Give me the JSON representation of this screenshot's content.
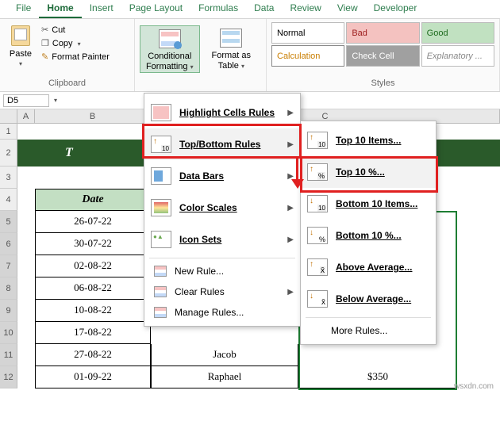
{
  "tabs": [
    "File",
    "Home",
    "Insert",
    "Page Layout",
    "Formulas",
    "Data",
    "Review",
    "View",
    "Developer"
  ],
  "active_tab": "Home",
  "clipboard": {
    "paste": "Paste",
    "cut": "Cut",
    "copy": "Copy",
    "format_painter": "Format Painter",
    "group_label": "Clipboard"
  },
  "cf": {
    "conditional": "Conditional Formatting",
    "format_as_table": "Format as Table"
  },
  "styles": {
    "normal": "Normal",
    "bad": "Bad",
    "good": "Good",
    "calculation": "Calculation",
    "check_cell": "Check Cell",
    "explanatory": "Explanatory ...",
    "group_label": "Styles"
  },
  "namebox": "D5",
  "col_headers": [
    "A",
    "B",
    "C"
  ],
  "row_headers": [
    "1",
    "2",
    "3",
    "4",
    "5",
    "6",
    "7",
    "8",
    "9",
    "10",
    "11",
    "12"
  ],
  "table": {
    "title_visible": "T",
    "headers": {
      "date": "Date",
      "col_c_hidden": "",
      "col_d_hidden": ""
    },
    "rows": [
      {
        "date": "26-07-22",
        "c": "",
        "d": ""
      },
      {
        "date": "30-07-22",
        "c": "",
        "d": ""
      },
      {
        "date": "02-08-22",
        "c": "",
        "d": ""
      },
      {
        "date": "06-08-22",
        "c": "",
        "d": ""
      },
      {
        "date": "10-08-22",
        "c": "",
        "d": ""
      },
      {
        "date": "17-08-22",
        "c": "",
        "d": ""
      },
      {
        "date": "27-08-22",
        "c": "Jacob",
        "d": ""
      },
      {
        "date": "01-09-22",
        "c": "Raphael",
        "d": "$350"
      }
    ]
  },
  "menu1": {
    "highlight": "Highlight Cells Rules",
    "topbottom": "Top/Bottom Rules",
    "databars": "Data Bars",
    "colorscales": "Color Scales",
    "iconsets": "Icon Sets",
    "newrule": "New Rule...",
    "clear": "Clear Rules",
    "manage": "Manage Rules..."
  },
  "menu2": {
    "top10items": "Top 10 Items...",
    "top10pct": "Top 10 %...",
    "bot10items": "Bottom 10 Items...",
    "bot10pct": "Bottom 10 %...",
    "aboveavg": "Above Average...",
    "belowavg": "Below Average...",
    "more": "More Rules..."
  },
  "watermark": "wsxdn.com"
}
